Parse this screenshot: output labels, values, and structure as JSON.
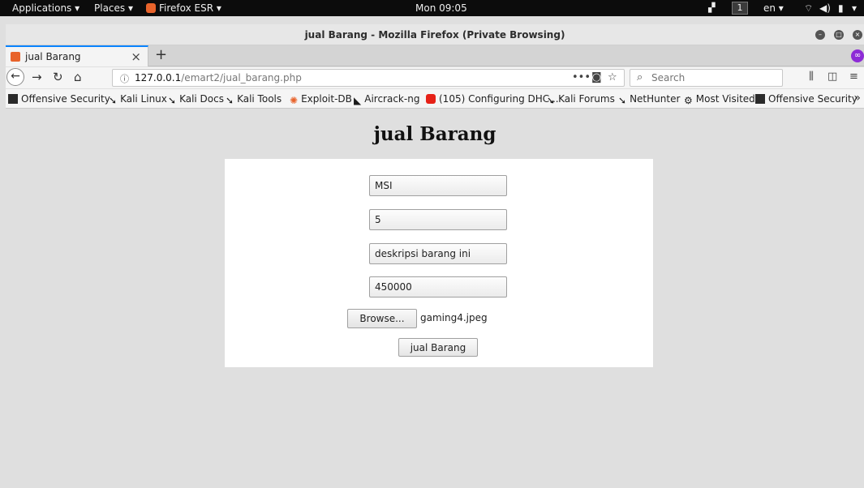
{
  "topbar": {
    "applications": "Applications ▾",
    "places": "Places ▾",
    "app_menu": "Firefox ESR ▾",
    "clock": "Mon 09:05",
    "workspace": "1",
    "language": "en ▾"
  },
  "window": {
    "title": "jual Barang - Mozilla Firefox (Private Browsing)"
  },
  "tab": {
    "label": "jual Barang"
  },
  "navbar": {
    "url_host": "127.0.0.1",
    "url_path": "/emart2/jual_barang.php",
    "search_placeholder": "Search"
  },
  "bookmarks": [
    {
      "label": "Offensive Security",
      "icon": "offsec"
    },
    {
      "label": "Kali Linux",
      "icon": "kali"
    },
    {
      "label": "Kali Docs",
      "icon": "kali"
    },
    {
      "label": "Kali Tools",
      "icon": "kali"
    },
    {
      "label": "Exploit-DB",
      "icon": "exploitdb"
    },
    {
      "label": "Aircrack-ng",
      "icon": "aircrack"
    },
    {
      "label": "(105) Configuring DHC...",
      "icon": "youtube"
    },
    {
      "label": "Kali Forums",
      "icon": "kali"
    },
    {
      "label": "NetHunter",
      "icon": "kali"
    },
    {
      "label": "Most Visited",
      "icon": "gear"
    },
    {
      "label": "Offensive Security",
      "icon": "offsec"
    }
  ],
  "page": {
    "heading": "jual Barang",
    "form": {
      "name_value": "MSI",
      "qty_value": "5",
      "desc_value": "deskripsi barang ini",
      "price_value": "450000",
      "browse_label": "Browse...",
      "file_name": "gaming4.jpeg",
      "submit_label": "jual Barang"
    }
  }
}
